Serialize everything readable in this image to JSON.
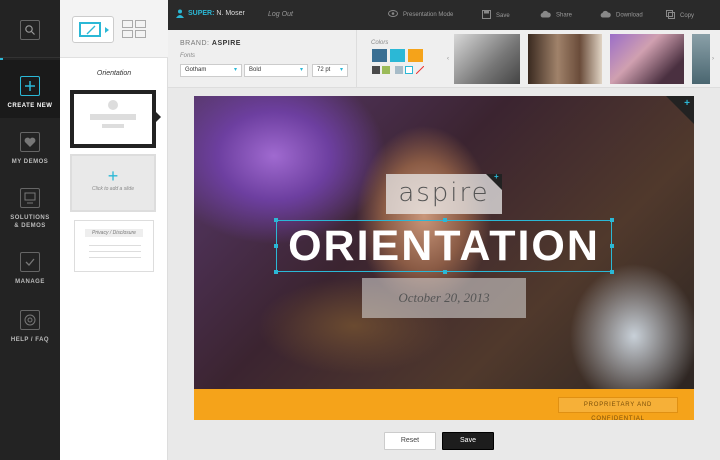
{
  "nav": {
    "items": [
      {
        "label_1": "CREATE NEW",
        "label_2": "",
        "icon": "plus-icon"
      },
      {
        "label_1": "MY DEMOS",
        "label_2": "",
        "icon": "heart-icon"
      },
      {
        "label_1": "SOLUTIONS",
        "label_2": "& DEMOS",
        "icon": "monitor-icon"
      },
      {
        "label_1": "MANAGE",
        "label_2": "",
        "icon": "check-icon"
      },
      {
        "label_1": "HELP / FAQ",
        "label_2": "",
        "icon": "lifebuoy-icon"
      }
    ]
  },
  "slides": {
    "caption": "Orientation",
    "add_label": "Click to add a slide",
    "add_symbol": "+",
    "disclosure_label": "Privacy / Disclosure"
  },
  "topbar": {
    "role": "SUPER:",
    "user": "N. Moser",
    "logout": "Log Out",
    "tools": [
      "Presentation Mode",
      "Save",
      "Share",
      "Download",
      "Copy"
    ]
  },
  "brandbar": {
    "brand_label": "BRAND:",
    "brand_name": "ASPIRE",
    "fonts_label": "Fonts",
    "font_family": "Gotham",
    "font_weight": "Bold",
    "font_size": "72 pt",
    "colors_label": "Colors",
    "swatches": [
      "#3a6f93",
      "#2bb8d6",
      "#f5a31a",
      "#4a4a4a",
      "#9bbb59",
      "#a7bcc8",
      "#ffffff"
    ]
  },
  "slide": {
    "brand_text": "aspire",
    "title": "ORIENTATION",
    "date": "October 20, 2013",
    "footer": "PROPRIETARY AND CONFIDENTIAL",
    "corner_symbol": "+"
  },
  "actions": {
    "reset": "Reset",
    "save": "Save"
  }
}
